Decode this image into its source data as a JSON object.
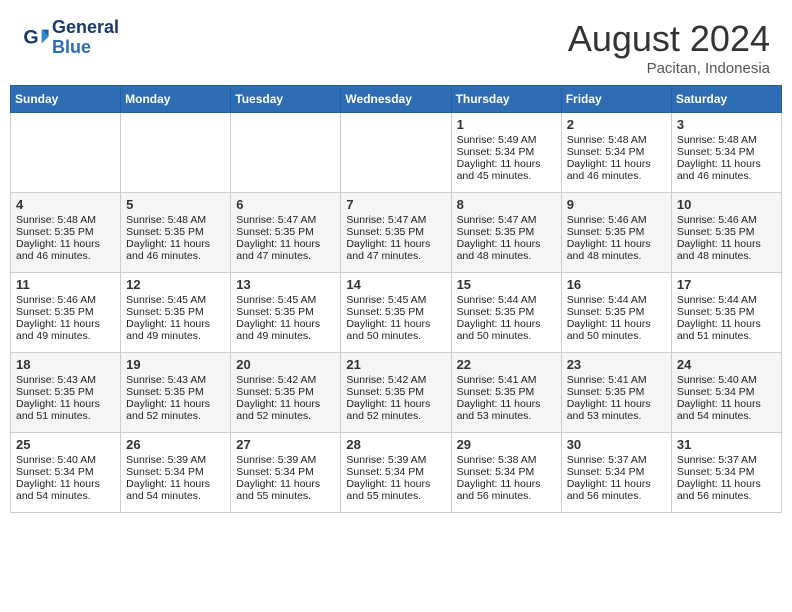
{
  "header": {
    "logo_line1": "General",
    "logo_line2": "Blue",
    "month": "August 2024",
    "location": "Pacitan, Indonesia"
  },
  "weekdays": [
    "Sunday",
    "Monday",
    "Tuesday",
    "Wednesday",
    "Thursday",
    "Friday",
    "Saturday"
  ],
  "weeks": [
    [
      {
        "day": "",
        "content": ""
      },
      {
        "day": "",
        "content": ""
      },
      {
        "day": "",
        "content": ""
      },
      {
        "day": "",
        "content": ""
      },
      {
        "day": "1",
        "content": "Sunrise: 5:49 AM\nSunset: 5:34 PM\nDaylight: 11 hours\nand 45 minutes."
      },
      {
        "day": "2",
        "content": "Sunrise: 5:48 AM\nSunset: 5:34 PM\nDaylight: 11 hours\nand 46 minutes."
      },
      {
        "day": "3",
        "content": "Sunrise: 5:48 AM\nSunset: 5:34 PM\nDaylight: 11 hours\nand 46 minutes."
      }
    ],
    [
      {
        "day": "4",
        "content": "Sunrise: 5:48 AM\nSunset: 5:35 PM\nDaylight: 11 hours\nand 46 minutes."
      },
      {
        "day": "5",
        "content": "Sunrise: 5:48 AM\nSunset: 5:35 PM\nDaylight: 11 hours\nand 46 minutes."
      },
      {
        "day": "6",
        "content": "Sunrise: 5:47 AM\nSunset: 5:35 PM\nDaylight: 11 hours\nand 47 minutes."
      },
      {
        "day": "7",
        "content": "Sunrise: 5:47 AM\nSunset: 5:35 PM\nDaylight: 11 hours\nand 47 minutes."
      },
      {
        "day": "8",
        "content": "Sunrise: 5:47 AM\nSunset: 5:35 PM\nDaylight: 11 hours\nand 48 minutes."
      },
      {
        "day": "9",
        "content": "Sunrise: 5:46 AM\nSunset: 5:35 PM\nDaylight: 11 hours\nand 48 minutes."
      },
      {
        "day": "10",
        "content": "Sunrise: 5:46 AM\nSunset: 5:35 PM\nDaylight: 11 hours\nand 48 minutes."
      }
    ],
    [
      {
        "day": "11",
        "content": "Sunrise: 5:46 AM\nSunset: 5:35 PM\nDaylight: 11 hours\nand 49 minutes."
      },
      {
        "day": "12",
        "content": "Sunrise: 5:45 AM\nSunset: 5:35 PM\nDaylight: 11 hours\nand 49 minutes."
      },
      {
        "day": "13",
        "content": "Sunrise: 5:45 AM\nSunset: 5:35 PM\nDaylight: 11 hours\nand 49 minutes."
      },
      {
        "day": "14",
        "content": "Sunrise: 5:45 AM\nSunset: 5:35 PM\nDaylight: 11 hours\nand 50 minutes."
      },
      {
        "day": "15",
        "content": "Sunrise: 5:44 AM\nSunset: 5:35 PM\nDaylight: 11 hours\nand 50 minutes."
      },
      {
        "day": "16",
        "content": "Sunrise: 5:44 AM\nSunset: 5:35 PM\nDaylight: 11 hours\nand 50 minutes."
      },
      {
        "day": "17",
        "content": "Sunrise: 5:44 AM\nSunset: 5:35 PM\nDaylight: 11 hours\nand 51 minutes."
      }
    ],
    [
      {
        "day": "18",
        "content": "Sunrise: 5:43 AM\nSunset: 5:35 PM\nDaylight: 11 hours\nand 51 minutes."
      },
      {
        "day": "19",
        "content": "Sunrise: 5:43 AM\nSunset: 5:35 PM\nDaylight: 11 hours\nand 52 minutes."
      },
      {
        "day": "20",
        "content": "Sunrise: 5:42 AM\nSunset: 5:35 PM\nDaylight: 11 hours\nand 52 minutes."
      },
      {
        "day": "21",
        "content": "Sunrise: 5:42 AM\nSunset: 5:35 PM\nDaylight: 11 hours\nand 52 minutes."
      },
      {
        "day": "22",
        "content": "Sunrise: 5:41 AM\nSunset: 5:35 PM\nDaylight: 11 hours\nand 53 minutes."
      },
      {
        "day": "23",
        "content": "Sunrise: 5:41 AM\nSunset: 5:35 PM\nDaylight: 11 hours\nand 53 minutes."
      },
      {
        "day": "24",
        "content": "Sunrise: 5:40 AM\nSunset: 5:34 PM\nDaylight: 11 hours\nand 54 minutes."
      }
    ],
    [
      {
        "day": "25",
        "content": "Sunrise: 5:40 AM\nSunset: 5:34 PM\nDaylight: 11 hours\nand 54 minutes."
      },
      {
        "day": "26",
        "content": "Sunrise: 5:39 AM\nSunset: 5:34 PM\nDaylight: 11 hours\nand 54 minutes."
      },
      {
        "day": "27",
        "content": "Sunrise: 5:39 AM\nSunset: 5:34 PM\nDaylight: 11 hours\nand 55 minutes."
      },
      {
        "day": "28",
        "content": "Sunrise: 5:39 AM\nSunset: 5:34 PM\nDaylight: 11 hours\nand 55 minutes."
      },
      {
        "day": "29",
        "content": "Sunrise: 5:38 AM\nSunset: 5:34 PM\nDaylight: 11 hours\nand 56 minutes."
      },
      {
        "day": "30",
        "content": "Sunrise: 5:37 AM\nSunset: 5:34 PM\nDaylight: 11 hours\nand 56 minutes."
      },
      {
        "day": "31",
        "content": "Sunrise: 5:37 AM\nSunset: 5:34 PM\nDaylight: 11 hours\nand 56 minutes."
      }
    ]
  ]
}
